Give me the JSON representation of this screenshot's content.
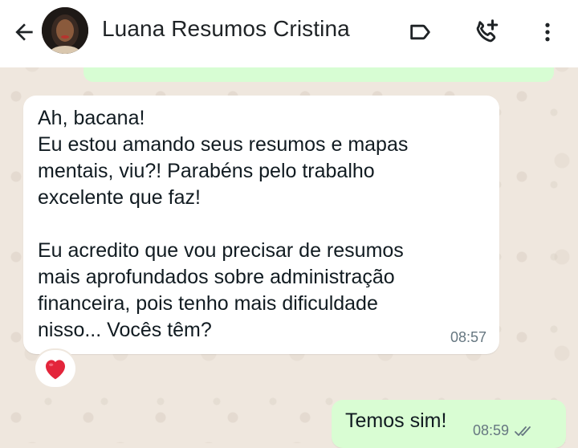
{
  "header": {
    "contact_name": "Luana Resumos Cristina",
    "icons": [
      "back-arrow-icon",
      "label-icon",
      "add-call-icon",
      "more-vert-icon"
    ]
  },
  "messages": {
    "incoming": {
      "lines_par1": [
        "Ah, bacana!",
        "Eu estou amando seus resumos e mapas",
        "mentais, viu?! Parabéns pelo trabalho",
        "excelente que faz!"
      ],
      "lines_par2": [
        "Eu acredito que vou precisar de resumos",
        "mais aprofundados sobre administração",
        "financeira, pois tenho mais dificuldade",
        "nisso... Vocês têm?"
      ],
      "time": "08:57",
      "reaction": "heart-emoji"
    },
    "outgoing": {
      "text": "Temos sim!",
      "time": "08:59",
      "status": "double-check-icon"
    }
  },
  "colors": {
    "chat_background": "#efe7de",
    "incoming_bubble": "#ffffff",
    "outgoing_bubble": "#d9fdd3",
    "header_background": "#ffffff",
    "timestamp": "#667781",
    "heart": "#e3253b"
  }
}
